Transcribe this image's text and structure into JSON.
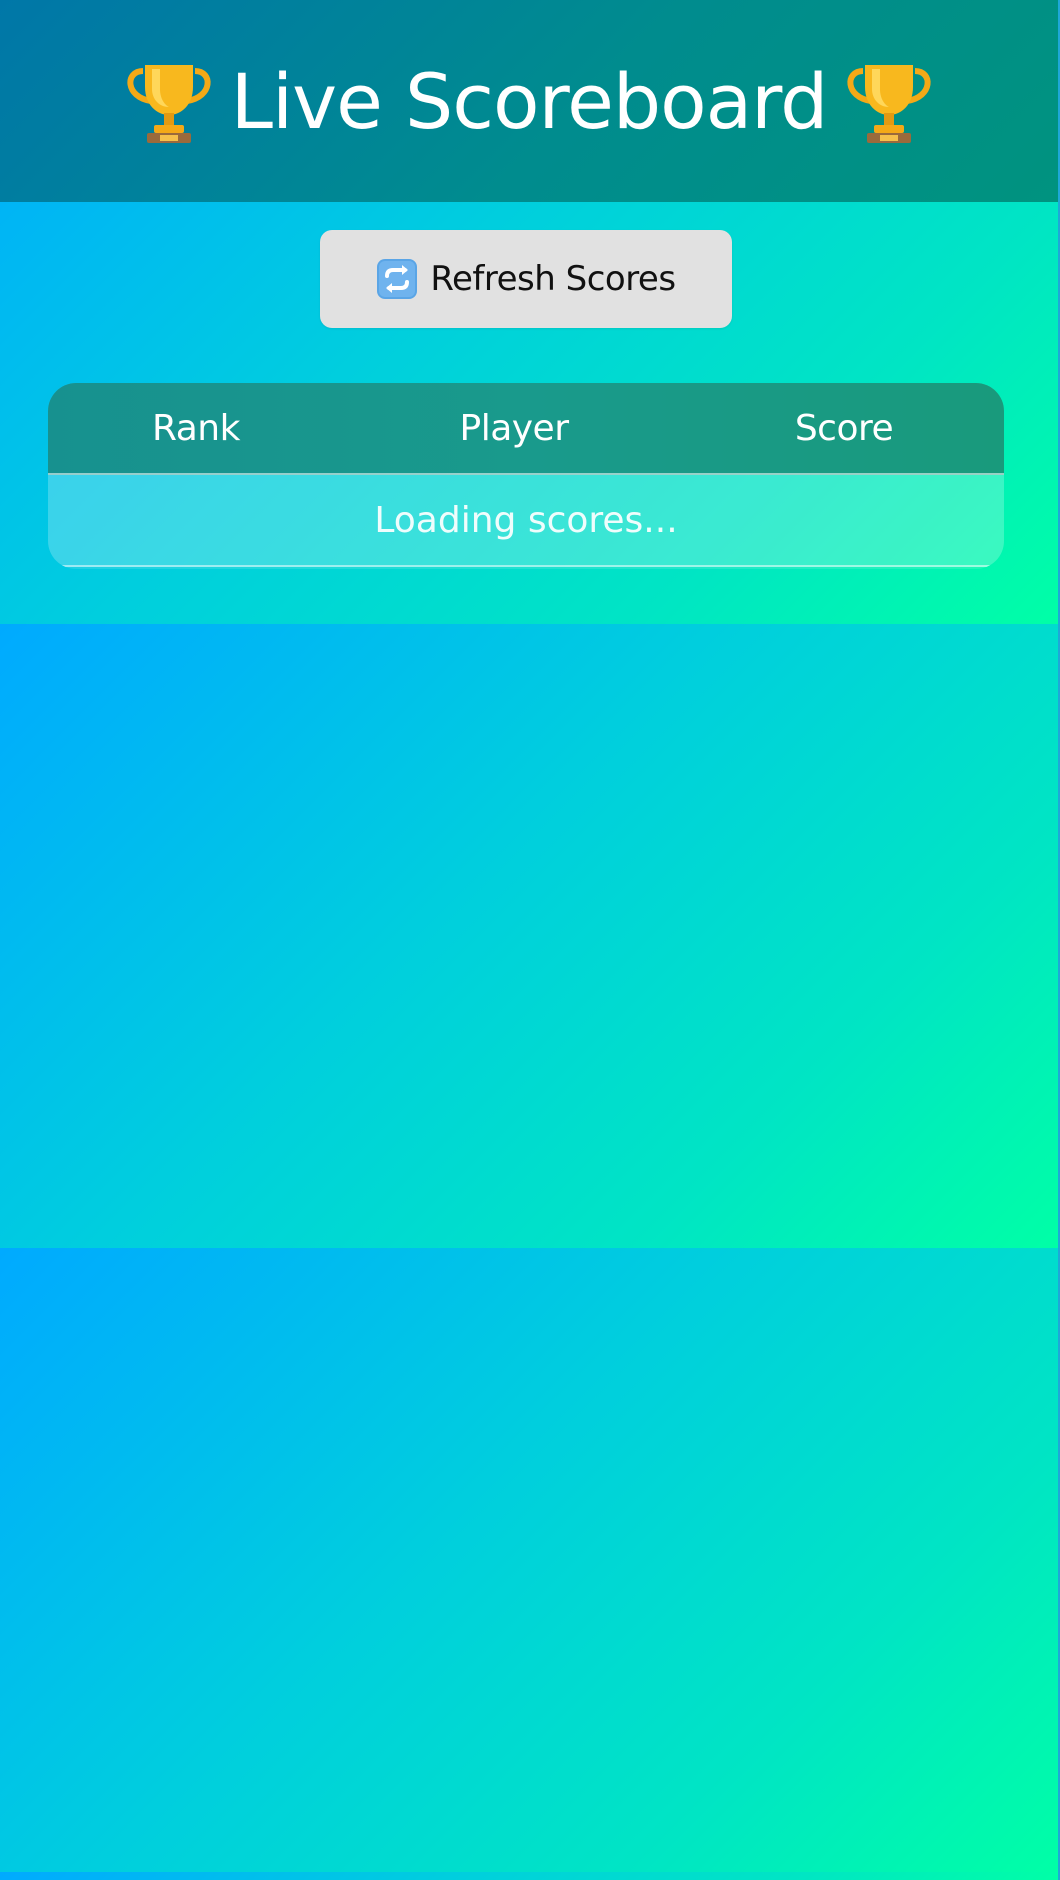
{
  "header": {
    "title": "Live Scoreboard",
    "left_icon": "trophy-icon",
    "right_icon": "trophy-icon"
  },
  "toolbar": {
    "refresh_icon": "refresh-icon",
    "refresh_label": "Refresh Scores"
  },
  "table": {
    "columns": [
      "Rank",
      "Player",
      "Score"
    ],
    "status_text": "Loading scores..."
  },
  "colors": {
    "header_start": "#0077a8",
    "header_end": "#00937f",
    "bg_start": "#00aaff",
    "bg_end": "#00ffa6",
    "button_bg": "#e1e1e1",
    "trophy_gold": "#f6b21a"
  }
}
